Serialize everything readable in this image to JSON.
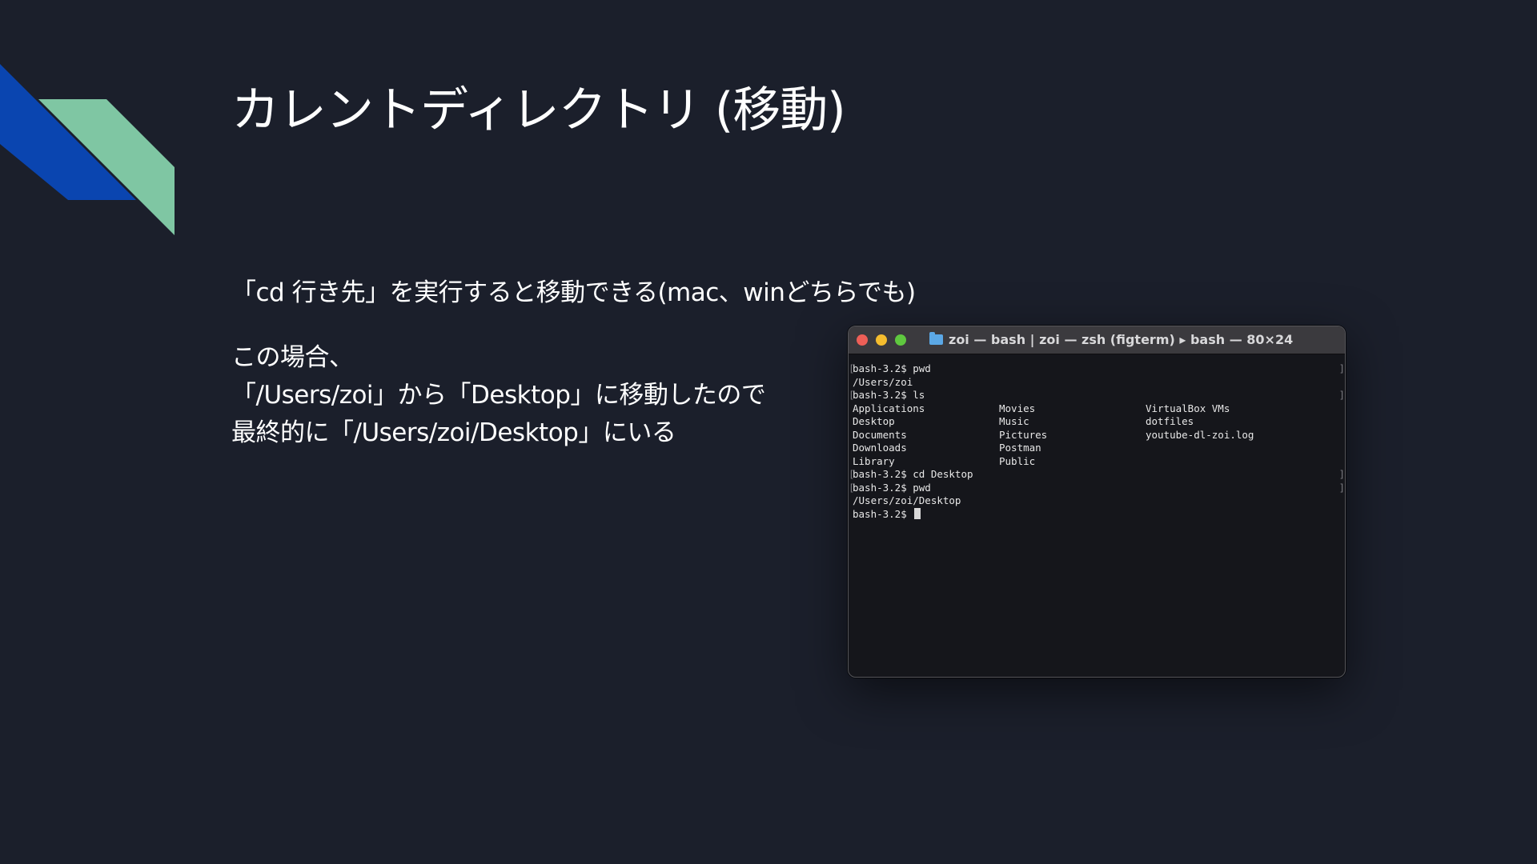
{
  "slide": {
    "title": "カレントディレクトリ (移動)",
    "line1": "「cd 行き先」を実行すると移動できる(mac、winどちらでも)",
    "para2": [
      "この場合、",
      "「/Users/zoi」から「Desktop」に移動したので",
      "最終的に「/Users/zoi/Desktop」にいる"
    ],
    "decor_colors": {
      "blue": "#0a45b0",
      "green": "#7fc6a3",
      "background": "#1b1f2b"
    }
  },
  "terminal": {
    "window_title": "zoi — bash | zoi — zsh (figterm) ▸ bash — 80×24",
    "icon": "folder-icon",
    "lines": [
      {
        "text": "bash-3.2$ pwd",
        "bracket": true
      },
      {
        "text": "/Users/zoi",
        "bracket": false
      },
      {
        "text": "bash-3.2$ ls",
        "bracket": true
      },
      {
        "cols": [
          "Applications",
          "Movies",
          "VirtualBox VMs"
        ]
      },
      {
        "cols": [
          "Desktop",
          "Music",
          "dotfiles"
        ]
      },
      {
        "cols": [
          "Documents",
          "Pictures",
          "youtube-dl-zoi.log"
        ]
      },
      {
        "cols": [
          "Downloads",
          "Postman",
          ""
        ]
      },
      {
        "cols": [
          "Library",
          "Public",
          ""
        ]
      },
      {
        "text": "bash-3.2$ cd Desktop",
        "bracket": true
      },
      {
        "text": "bash-3.2$ pwd",
        "bracket": true
      },
      {
        "text": "/Users/zoi/Desktop",
        "bracket": false
      },
      {
        "text": "bash-3.2$ ",
        "bracket": false,
        "cursor": true
      }
    ]
  }
}
